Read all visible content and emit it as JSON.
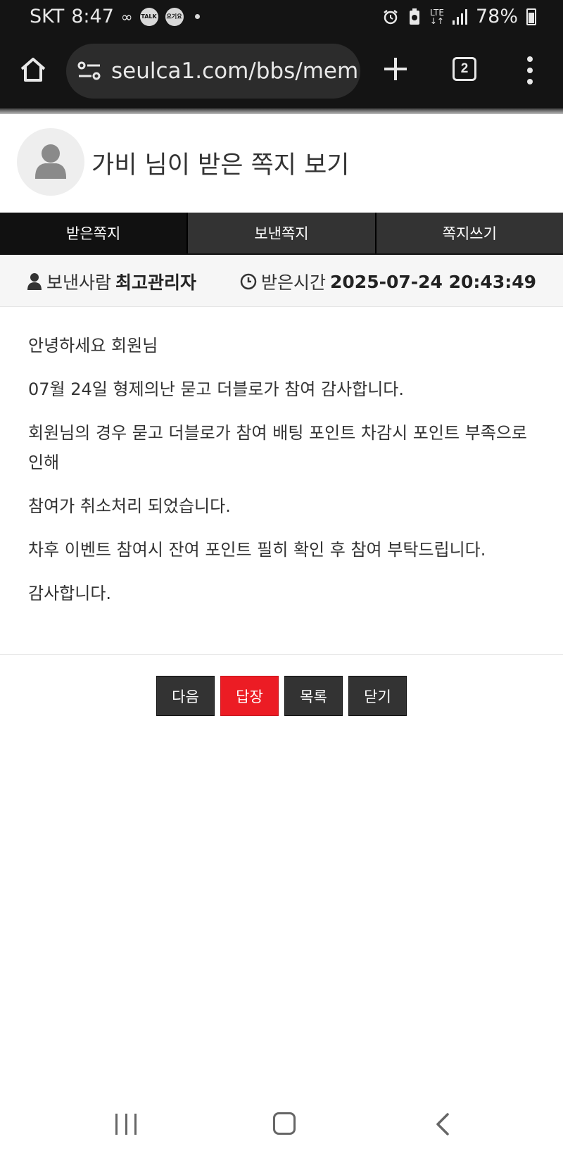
{
  "status_bar": {
    "carrier": "SKT",
    "time": "8:47",
    "talk_icon_label": "TALK",
    "yogiyo_icon_label": "요기요",
    "network": "LTE",
    "battery": "78%"
  },
  "browser": {
    "url": "seulca1.com/bbs/mem",
    "tab_count": "2"
  },
  "header": {
    "title": "가비 님이 받은 쪽지 보기"
  },
  "tabs": [
    {
      "label": "받은쪽지",
      "active": true
    },
    {
      "label": "보낸쪽지",
      "active": false
    },
    {
      "label": "쪽지쓰기",
      "active": false
    }
  ],
  "info": {
    "sender_label": "보낸사람",
    "sender_name": "최고관리자",
    "received_label": "받은시간",
    "received_time": "2025-07-24 20:43:49"
  },
  "message": {
    "lines": [
      "안녕하세요 회원님",
      "07월 24일 형제의난 묻고 더블로가 참여 감사합니다.",
      "회원님의 경우 묻고 더블로가 참여 배팅 포인트 차감시 포인트 부족으로 인해",
      "참여가 취소처리 되었습니다.",
      "차후 이벤트 참여시 잔여 포인트 필히 확인 후 참여 부탁드립니다.",
      "감사합니다."
    ]
  },
  "buttons": {
    "next": "다음",
    "reply": "답장",
    "list": "목록",
    "close": "닫기"
  },
  "colors": {
    "reply_button": "#ec1c24",
    "dark_button": "#333333",
    "active_tab": "#111111"
  }
}
